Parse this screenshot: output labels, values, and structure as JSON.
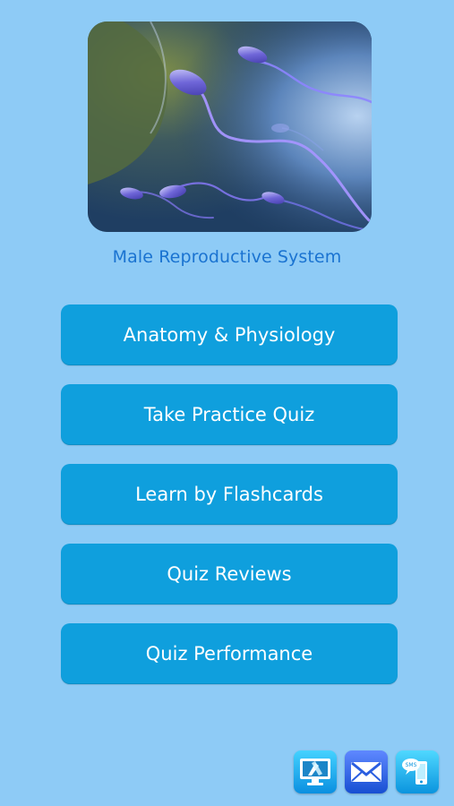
{
  "hero": {
    "icon": "sperm-cells-illustration"
  },
  "app": {
    "subtitle": "Male Reproductive System"
  },
  "menu": {
    "buttons": [
      {
        "label": "Anatomy & Physiology"
      },
      {
        "label": "Take Practice Quiz"
      },
      {
        "label": "Learn by Flashcards"
      },
      {
        "label": "Quiz Reviews"
      },
      {
        "label": "Quiz Performance"
      }
    ]
  },
  "footer": {
    "icons": [
      {
        "name": "desktop-tools-icon"
      },
      {
        "name": "mail-icon"
      },
      {
        "name": "sms-icon"
      }
    ],
    "sms_text": "SMS"
  },
  "colors": {
    "background": "#8ecbf6",
    "button": "#0f9fdd",
    "title": "#1a73d1"
  }
}
